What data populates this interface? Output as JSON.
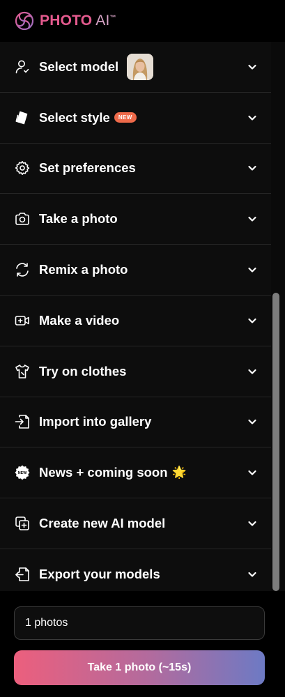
{
  "header": {
    "brand_photo": "PHOTO",
    "brand_ai": "AI",
    "brand_tm": "™",
    "logo_icon": "swirl-logo-icon"
  },
  "menu": {
    "items": [
      {
        "label": "Select model",
        "icon": "user-icon"
      },
      {
        "label": "Select style",
        "icon": "cards-icon",
        "badge": "NEW"
      },
      {
        "label": "Set preferences",
        "icon": "gear-icon"
      },
      {
        "label": "Take a photo",
        "icon": "camera-icon"
      },
      {
        "label": "Remix a photo",
        "icon": "refresh-icon"
      },
      {
        "label": "Make a video",
        "icon": "video-plus-icon"
      },
      {
        "label": "Try on clothes",
        "icon": "shirt-icon"
      },
      {
        "label": "Import into gallery",
        "icon": "import-icon"
      },
      {
        "label": "News + coming soon",
        "icon": "new-badge-icon",
        "emoji": "🌟"
      },
      {
        "label": "Create new AI model",
        "icon": "copy-plus-icon"
      },
      {
        "label": "Export your models",
        "icon": "export-icon"
      }
    ]
  },
  "bottom": {
    "photo_count_value": "1 photos",
    "take_button_label": "Take 1 photo (~15s)"
  },
  "colors": {
    "brand_pink": "#e45a8e",
    "badge_orange": "#ee6a4a",
    "button_gradient_start": "#ec5f7d",
    "button_gradient_end": "#6d7ac4"
  }
}
